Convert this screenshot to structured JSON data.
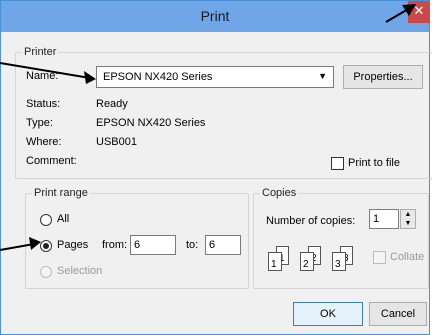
{
  "dialog": {
    "title": "Print",
    "close_glyph": "✕"
  },
  "printer": {
    "group_label": "Printer",
    "name_label": "Name:",
    "name_value": "EPSON NX420 Series",
    "properties_label": "Properties...",
    "status_label": "Status:",
    "status_value": "Ready",
    "type_label": "Type:",
    "type_value": "EPSON NX420 Series",
    "where_label": "Where:",
    "where_value": "USB001",
    "comment_label": "Comment:",
    "print_to_file_label": "Print to file",
    "print_to_file_checked": false
  },
  "print_range": {
    "group_label": "Print range",
    "all_label": "All",
    "pages_label": "Pages",
    "from_label": "from:",
    "from_value": "6",
    "to_label": "to:",
    "to_value": "6",
    "selection_label": "Selection",
    "selected": "pages"
  },
  "copies": {
    "group_label": "Copies",
    "number_label": "Number of copies:",
    "number_value": "1",
    "collate_label": "Collate",
    "collate_checked": false,
    "collate_pages": [
      "1",
      "1",
      "2",
      "2",
      "3",
      "3"
    ]
  },
  "footer": {
    "ok_label": "OK",
    "cancel_label": "Cancel"
  },
  "colors": {
    "titlebar": "#6ea6e8",
    "close": "#c94a4a",
    "dialog_bg": "#f0f0f0"
  }
}
